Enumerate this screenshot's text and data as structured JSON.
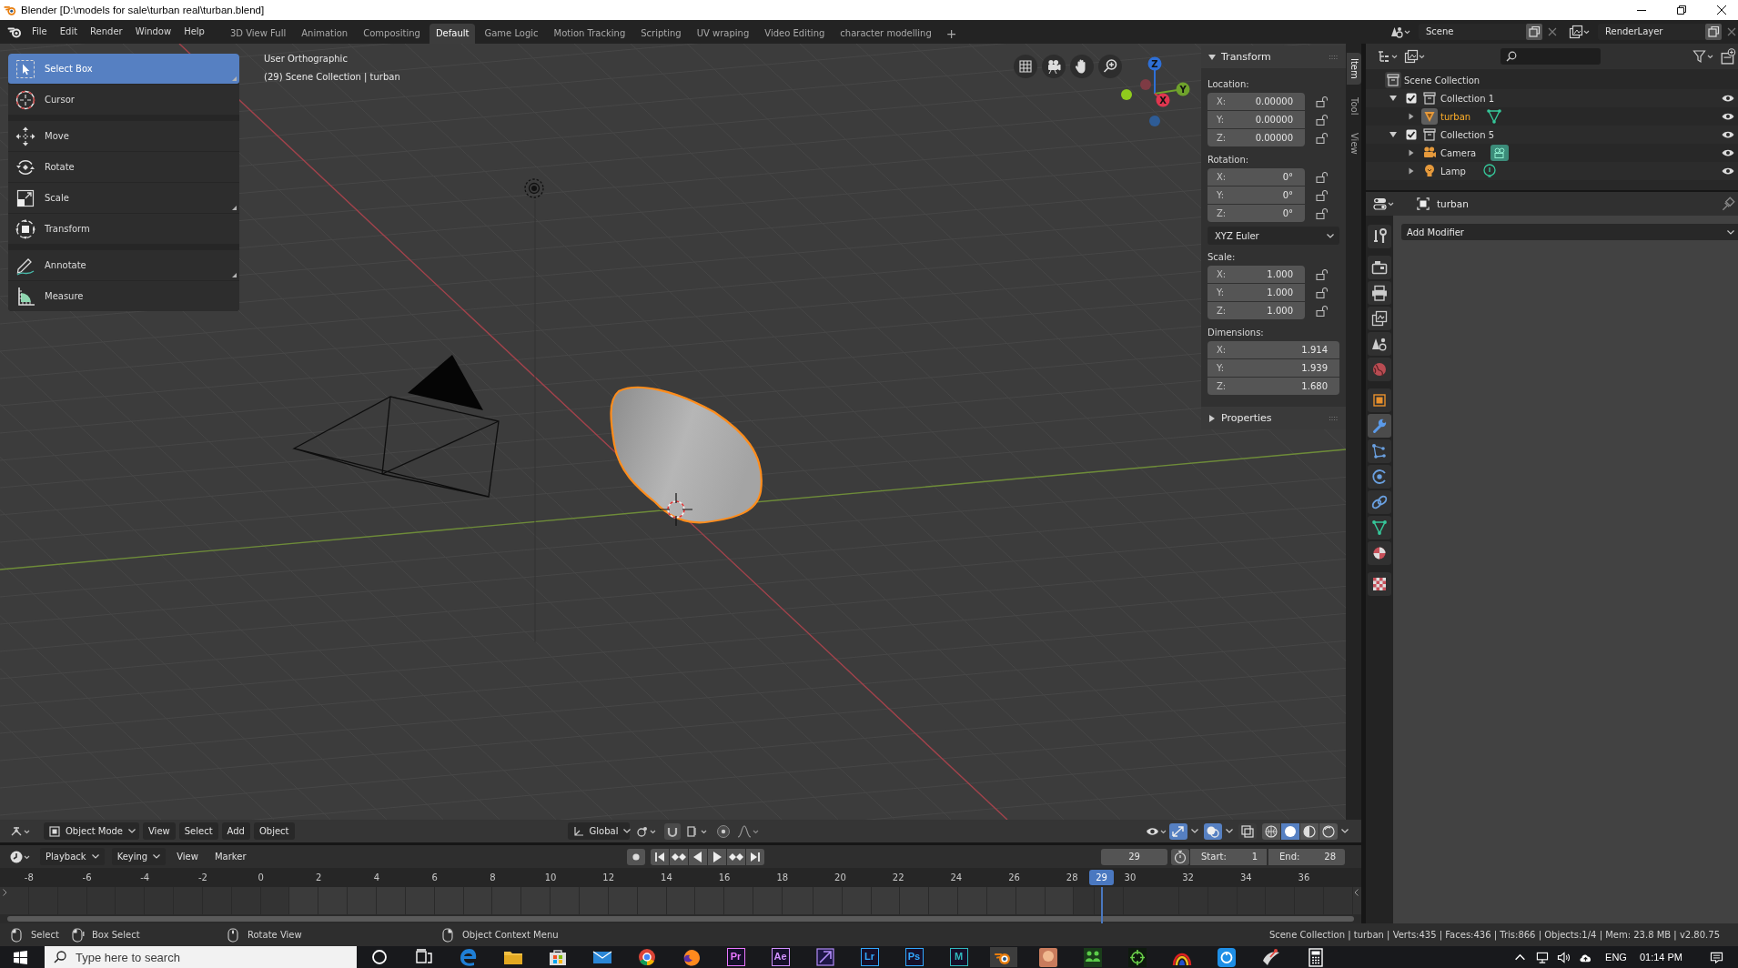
{
  "window": {
    "title": "Blender [D:\\models for sale\\turban real\\turban.blend]"
  },
  "topbar": {
    "menus": [
      "File",
      "Edit",
      "Render",
      "Window",
      "Help"
    ],
    "workspaces": [
      {
        "label": "3D View Full",
        "selected": false
      },
      {
        "label": "Animation",
        "selected": false
      },
      {
        "label": "Compositing",
        "selected": false
      },
      {
        "label": "Default",
        "selected": true
      },
      {
        "label": "Game Logic",
        "selected": false
      },
      {
        "label": "Motion Tracking",
        "selected": false
      },
      {
        "label": "Scripting",
        "selected": false
      },
      {
        "label": "UV wraping",
        "selected": false
      },
      {
        "label": "Video Editing",
        "selected": false
      },
      {
        "label": "character modelling",
        "selected": false
      }
    ],
    "add_workspace": "+",
    "scene": "Scene",
    "view_layer": "RenderLayer"
  },
  "viewport": {
    "view_name": "User Orthographic",
    "view_info": "(29) Scene Collection | turban",
    "tool_groups": [
      {
        "tools": [
          {
            "kind": "select_box",
            "label": "Select Box",
            "selected": true,
            "variants": true
          },
          {
            "kind": "cursor",
            "label": "Cursor",
            "selected": false,
            "variants": false
          }
        ]
      },
      {
        "tools": [
          {
            "kind": "move",
            "label": "Move",
            "selected": false,
            "variants": false
          },
          {
            "kind": "rotate",
            "label": "Rotate",
            "selected": false,
            "variants": false
          },
          {
            "kind": "scale",
            "label": "Scale",
            "selected": false,
            "variants": true
          },
          {
            "kind": "transform",
            "label": "Transform",
            "selected": false,
            "variants": false
          }
        ]
      },
      {
        "tools": [
          {
            "kind": "annotate",
            "label": "Annotate",
            "selected": false,
            "variants": true
          },
          {
            "kind": "measure",
            "label": "Measure",
            "selected": false,
            "variants": false
          }
        ]
      }
    ],
    "gizmo_axes": [
      "X",
      "Y",
      "Z"
    ],
    "sidebar": {
      "tabs": [
        {
          "label": "Item",
          "selected": true
        },
        {
          "label": "Tool",
          "selected": false
        },
        {
          "label": "View",
          "selected": false
        }
      ],
      "panels": [
        {
          "title": "Transform",
          "expanded": true,
          "groups": [
            {
              "kind": "vector_lock",
              "label": "Location:",
              "fields": [
                {
                  "axis": "X:",
                  "value": "0.00000",
                  "locked": false
                },
                {
                  "axis": "Y:",
                  "value": "0.00000",
                  "locked": false
                },
                {
                  "axis": "Z:",
                  "value": "0.00000",
                  "locked": false
                }
              ]
            },
            {
              "kind": "vector_lock",
              "label": "Rotation:",
              "fields": [
                {
                  "axis": "X:",
                  "value": "0°",
                  "locked": false
                },
                {
                  "axis": "Y:",
                  "value": "0°",
                  "locked": false
                },
                {
                  "axis": "Z:",
                  "value": "0°",
                  "locked": false
                }
              ]
            },
            {
              "kind": "dropdown",
              "value": "XYZ Euler"
            },
            {
              "kind": "vector_lock",
              "label": "Scale:",
              "fields": [
                {
                  "axis": "X:",
                  "value": "1.000",
                  "locked": false
                },
                {
                  "axis": "Y:",
                  "value": "1.000",
                  "locked": false
                },
                {
                  "axis": "Z:",
                  "value": "1.000",
                  "locked": false
                }
              ]
            },
            {
              "kind": "vector",
              "label": "Dimensions:",
              "fields": [
                {
                  "axis": "X:",
                  "value": "1.914"
                },
                {
                  "axis": "Y:",
                  "value": "1.939"
                },
                {
                  "axis": "Z:",
                  "value": "1.680"
                }
              ]
            }
          ]
        },
        {
          "title": "Properties",
          "expanded": false
        }
      ]
    },
    "header": {
      "mode": "Object Mode",
      "menus": [
        "View",
        "Select",
        "Add",
        "Object"
      ],
      "orientation": "Global",
      "toggles": [
        {
          "kind": "gizmos",
          "on": true
        },
        {
          "kind": "overlays",
          "on": true
        },
        {
          "kind": "xray",
          "on": false
        }
      ],
      "shading": [
        {
          "kind": "wireframe",
          "selected": false
        },
        {
          "kind": "solid",
          "selected": true
        },
        {
          "kind": "material",
          "selected": false
        },
        {
          "kind": "rendered",
          "selected": false
        }
      ]
    }
  },
  "timeline": {
    "menus": [
      {
        "label": "Playback",
        "kind": "dropdown"
      },
      {
        "label": "Keying",
        "kind": "dropdown"
      },
      {
        "label": "View",
        "kind": "menu"
      },
      {
        "label": "Marker",
        "kind": "menu"
      }
    ],
    "current_frame": "29",
    "start_label": "Start:",
    "start": "1",
    "end_label": "End:",
    "end": "28",
    "ruler": [
      "-8",
      "-6",
      "-4",
      "-2",
      "0",
      "2",
      "4",
      "6",
      "8",
      "10",
      "12",
      "14",
      "16",
      "18",
      "20",
      "22",
      "24",
      "26",
      "28",
      "30",
      "32",
      "34",
      "36"
    ],
    "playhead": "29"
  },
  "outliner": {
    "tree": {
      "label": "Scene Collection",
      "kind": "scene_collection",
      "selected": false,
      "children": [
        {
          "label": "Collection 1",
          "kind": "collection",
          "selected": false,
          "expanded": true,
          "checked": true,
          "visible": true,
          "children": [
            {
              "label": "turban",
              "kind": "mesh",
              "selected": true,
              "expanded": false,
              "visible": true
            }
          ]
        },
        {
          "label": "Collection 5",
          "kind": "collection",
          "selected": false,
          "expanded": true,
          "checked": true,
          "visible": true,
          "children": [
            {
              "label": "Camera",
              "kind": "camera",
              "selected": false,
              "expanded": false,
              "visible": true
            },
            {
              "label": "Lamp",
              "kind": "light",
              "selected": false,
              "expanded": false,
              "visible": true
            }
          ]
        }
      ]
    }
  },
  "properties": {
    "object": "turban",
    "tab_groups": [
      {
        "tabs": [
          {
            "kind": "tool",
            "selected": false
          }
        ]
      },
      {
        "tabs": [
          {
            "kind": "render",
            "selected": false
          },
          {
            "kind": "output",
            "selected": false
          },
          {
            "kind": "view_layer",
            "selected": false
          },
          {
            "kind": "scene",
            "selected": false
          },
          {
            "kind": "world",
            "selected": false
          }
        ]
      },
      {
        "tabs": [
          {
            "kind": "object",
            "selected": false
          },
          {
            "kind": "modifiers",
            "selected": true
          },
          {
            "kind": "particles",
            "selected": false
          },
          {
            "kind": "physics",
            "selected": false
          },
          {
            "kind": "constraints",
            "selected": false
          },
          {
            "kind": "data",
            "selected": false
          },
          {
            "kind": "material",
            "selected": false
          }
        ]
      },
      {
        "tabs": [
          {
            "kind": "texture",
            "selected": false
          }
        ]
      }
    ],
    "add_modifier": "Add Modifier"
  },
  "status_bar": {
    "hints": [
      {
        "kind": "lmb",
        "label": "Select"
      },
      {
        "kind": "drag",
        "label": "Box Select"
      },
      {
        "kind": "mmb",
        "label": "Rotate View"
      },
      {
        "kind": "rmb",
        "label": "Object Context Menu"
      }
    ],
    "stats": "Scene Collection | turban | Verts:435 | Faces:436 | Tris:866 | Objects:1/4 | Mem: 23.8 MB | v2.80.75"
  },
  "taskbar": {
    "search": {
      "placeholder": "Type here to search"
    },
    "apps": [
      {
        "kind": "cortana",
        "selected": false
      },
      {
        "kind": "task_view",
        "selected": false
      },
      {
        "kind": "edge",
        "selected": false
      },
      {
        "kind": "folder",
        "selected": false
      },
      {
        "kind": "store",
        "selected": false
      },
      {
        "kind": "mail",
        "selected": false
      },
      {
        "kind": "chrome",
        "selected": false
      },
      {
        "kind": "firefox",
        "selected": false
      },
      {
        "kind": "letter",
        "label": "Pr",
        "color": "#ea77ff",
        "selected": false
      },
      {
        "kind": "letter",
        "label": "Ae",
        "color": "#d291ff",
        "selected": false
      },
      {
        "kind": "tile",
        "selected": false
      },
      {
        "kind": "letter",
        "label": "Lr",
        "color": "#31a8ff",
        "selected": false
      },
      {
        "kind": "letter",
        "label": "Ps",
        "color": "#31a8ff",
        "selected": false
      },
      {
        "kind": "letter",
        "label": "M",
        "color": "#30b8bd",
        "selected": false
      },
      {
        "kind": "blender",
        "selected": true
      },
      {
        "kind": "avatar",
        "selected": false
      },
      {
        "kind": "people",
        "selected": false
      },
      {
        "kind": "target",
        "selected": false
      },
      {
        "kind": "rainbow",
        "selected": false
      },
      {
        "kind": "blue_app",
        "selected": false
      },
      {
        "kind": "dish",
        "selected": false
      },
      {
        "kind": "calculator",
        "selected": false
      }
    ],
    "language": "ENG",
    "time": "01:14 PM"
  }
}
